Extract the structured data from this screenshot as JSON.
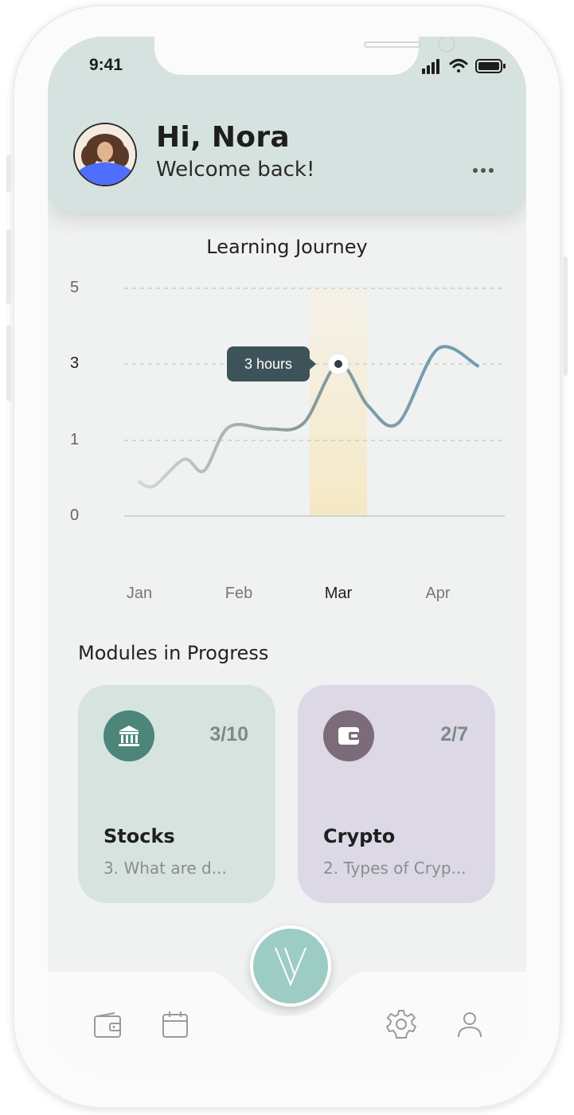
{
  "status_bar": {
    "time": "9:41"
  },
  "header": {
    "greeting": "Hi, Nora",
    "subtitle": "Welcome back!",
    "menu_icon": "more-horizontal-icon"
  },
  "chart_data": {
    "type": "line",
    "title": "Learning Journey",
    "x_categories": [
      "Jan",
      "Feb",
      "Mar",
      "Apr"
    ],
    "highlighted_category": "Mar",
    "y_ticks": [
      0,
      1,
      3,
      5
    ],
    "tooltip": "3 hours",
    "series": [
      {
        "x": [
          0,
          0.15,
          0.45,
          0.65,
          0.9,
          1.3,
          1.65,
          2.0,
          2.3,
          2.6,
          3.0,
          3.4
        ],
        "y": [
          0.45,
          0.4,
          0.75,
          0.6,
          1.35,
          1.3,
          1.45,
          3.0,
          1.9,
          1.45,
          3.4,
          2.95
        ]
      }
    ]
  },
  "modules": {
    "title": "Modules in Progress",
    "cards": [
      {
        "icon": "bank-icon",
        "count": "3/10",
        "title": "Stocks",
        "subtitle": "3. What are d...",
        "color": "#d7e3df",
        "icon_color": "#4b8678"
      },
      {
        "icon": "wallet-icon",
        "count": "2/7",
        "title": "Crypto",
        "subtitle": "2. Types of Cryp...",
        "color": "#dcd8e5",
        "icon_color": "#7d6b7a"
      }
    ]
  },
  "bottom_nav": {
    "items": [
      "wallet-icon",
      "calendar-icon",
      "settings-icon",
      "profile-icon"
    ],
    "center_button": "logo-icon"
  }
}
